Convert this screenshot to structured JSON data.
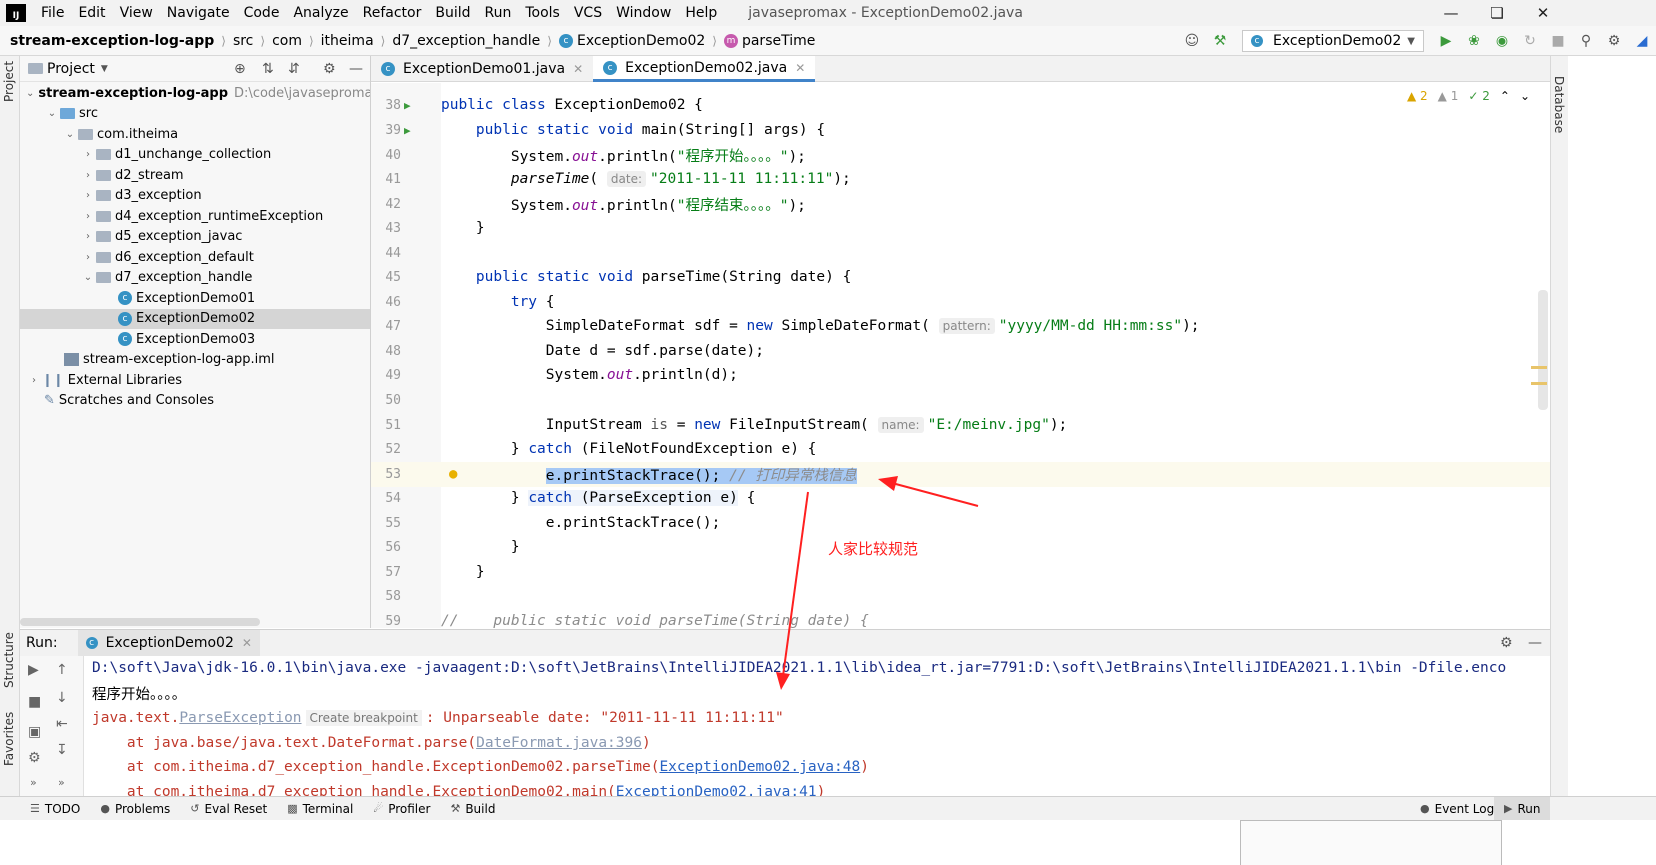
{
  "window": {
    "title": "javasepromax - ExceptionDemo02.java",
    "logo": "IJ"
  },
  "menu": [
    "File",
    "Edit",
    "View",
    "Navigate",
    "Code",
    "Analyze",
    "Refactor",
    "Build",
    "Run",
    "Tools",
    "VCS",
    "Window",
    "Help"
  ],
  "breadcrumb": {
    "project": "stream-exception-log-app",
    "src": "src",
    "pkg1": "com",
    "pkg2": "itheima",
    "pkg3": "d7_exception_handle",
    "file": "ExceptionDemo02",
    "method": "parseTime"
  },
  "toolbar": {
    "run_config": "ExceptionDemo02"
  },
  "project_panel": {
    "title": "Project",
    "root": "stream-exception-log-app",
    "root_path": "D:\\code\\javasepromax",
    "src": "src",
    "package": "com.itheima",
    "folders": [
      "d1_unchange_collection",
      "d2_stream",
      "d3_exception",
      "d4_exception_runtimeException",
      "d5_exception_javac",
      "d6_exception_default",
      "d7_exception_handle"
    ],
    "files": [
      "ExceptionDemo01",
      "ExceptionDemo02",
      "ExceptionDemo03"
    ],
    "iml": "stream-exception-log-app.iml",
    "external": "External Libraries",
    "scratches": "Scratches and Consoles"
  },
  "editor": {
    "tabs": [
      "ExceptionDemo01.java",
      "ExceptionDemo02.java"
    ],
    "status": {
      "warnings": "2",
      "weak_warnings": "1",
      "ok": "2"
    },
    "lines": [
      {
        "n": "38",
        "code": "public class ExceptionDemo02 {"
      },
      {
        "n": "39",
        "code": "    public static void main(String[] args) {"
      },
      {
        "n": "40",
        "code": "        System.out.println(\"程序开始。。。。\");"
      },
      {
        "n": "41",
        "code": "        parseTime( date: \"2011-11-11 11:11:11\");"
      },
      {
        "n": "42",
        "code": "        System.out.println(\"程序结束。。。。\");"
      },
      {
        "n": "43",
        "code": "    }"
      },
      {
        "n": "44",
        "code": ""
      },
      {
        "n": "45",
        "code": "    public static void parseTime(String date) {"
      },
      {
        "n": "46",
        "code": "        try {"
      },
      {
        "n": "47",
        "code": "            SimpleDateFormat sdf = new SimpleDateFormat( pattern: \"yyyy/MM-dd HH:mm:ss\");"
      },
      {
        "n": "48",
        "code": "            Date d = sdf.parse(date);"
      },
      {
        "n": "49",
        "code": "            System.out.println(d);"
      },
      {
        "n": "50",
        "code": ""
      },
      {
        "n": "51",
        "code": "            InputStream is = new FileInputStream( name: \"E:/meinv.jpg\");"
      },
      {
        "n": "52",
        "code": "        } catch (FileNotFoundException e) {"
      },
      {
        "n": "53",
        "code": "            e.printStackTrace(); // 打印异常栈信息"
      },
      {
        "n": "54",
        "code": "        } catch (ParseException e) {"
      },
      {
        "n": "55",
        "code": "            e.printStackTrace();"
      },
      {
        "n": "56",
        "code": "        }"
      },
      {
        "n": "57",
        "code": "    }"
      },
      {
        "n": "58",
        "code": ""
      },
      {
        "n": "59",
        "code": "//    public static void parseTime(String date) {"
      }
    ]
  },
  "run_panel": {
    "label": "Run:",
    "tab": "ExceptionDemo02",
    "console": {
      "cmd": "D:\\soft\\Java\\jdk-16.0.1\\bin\\java.exe -javaagent:D:\\soft\\JetBrains\\IntelliJIDEA2021.1.1\\lib\\idea_rt.jar=7791:D:\\soft\\JetBrains\\IntelliJIDEA2021.1.1\\bin -Dfile.enco",
      "out1": "程序开始。。。。",
      "exc_prefix": "java.text.",
      "exc_class": "ParseException",
      "breakpoint": "Create breakpoint",
      "exc_msg": ": Unparseable date: \"2011-11-11 11:11:11\"",
      "trace1_prefix": "    at java.base/java.text.DateFormat.parse(",
      "trace1_link": "DateFormat.java:396",
      "trace2_prefix": "    at com.itheima.d7_exception_handle.ExceptionDemo02.parseTime(",
      "trace2_link": "ExceptionDemo02.java:48",
      "trace3_prefix": "    at com.itheima.d7_exception_handle.ExceptionDemo02.main(",
      "trace3_link": "ExceptionDemo02.java:41"
    }
  },
  "bottom_bar": {
    "items": [
      "TODO",
      "Problems",
      "Eval Reset",
      "Terminal",
      "Profiler",
      "Build"
    ],
    "event_log": "Event Log",
    "run": "Run"
  },
  "side_stripes": {
    "left_top": "Project",
    "left_structure": "Structure",
    "left_favorites": "Favorites",
    "right": "Database"
  },
  "annotation": {
    "text": "人家比较规范",
    "color": "#ff2020"
  },
  "colors": {
    "keyword": "#0033b3",
    "string": "#067d17",
    "selection": "#a6c9f5",
    "link": "#2862c2",
    "error": "#c0392b"
  }
}
